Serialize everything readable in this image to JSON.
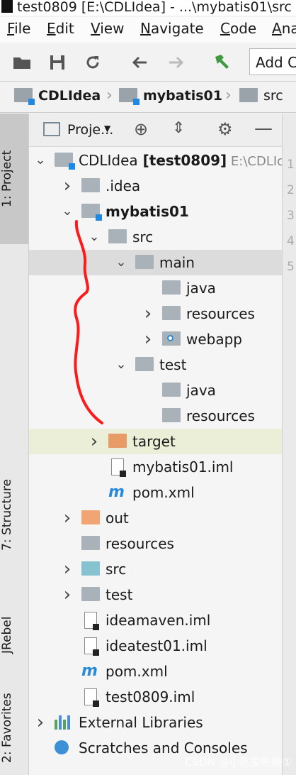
{
  "title": "test0809 [E:\\CDLIdea] - ...\\mybatis01\\src",
  "menu": [
    "File",
    "Edit",
    "View",
    "Navigate",
    "Code",
    "Analyze"
  ],
  "toolbar": {
    "icons": [
      "open-folder-icon",
      "save-icon",
      "refresh-icon",
      "back-arrow-icon",
      "forward-arrow-icon",
      "hammer-icon"
    ],
    "add_config": "Add C"
  },
  "breadcrumb": [
    "CDLIdea",
    "mybatis01",
    "src"
  ],
  "side_tabs": {
    "project": "1: Project",
    "structure": "7: Structure",
    "jrebel": "JRebel",
    "favorites": "2: Favorites"
  },
  "panel": {
    "title": "Proje..."
  },
  "tree": [
    {
      "indent": 0,
      "arrow": "down",
      "icon": "module",
      "label": "CDLIdea",
      "bold_suffix": "[test0809]",
      "path": "E:\\CDLIdea"
    },
    {
      "indent": 1,
      "arrow": "right",
      "icon": "folder",
      "label": ".idea"
    },
    {
      "indent": 1,
      "arrow": "down",
      "icon": "module",
      "label": "mybatis01",
      "bold": true
    },
    {
      "indent": 2,
      "arrow": "down",
      "icon": "folder",
      "label": "src"
    },
    {
      "indent": 3,
      "arrow": "down",
      "icon": "folder",
      "label": "main",
      "sel": true
    },
    {
      "indent": 4,
      "arrow": "",
      "icon": "folder",
      "label": "java"
    },
    {
      "indent": 4,
      "arrow": "right",
      "icon": "folder",
      "label": "resources"
    },
    {
      "indent": 4,
      "arrow": "right",
      "icon": "web",
      "label": "webapp"
    },
    {
      "indent": 3,
      "arrow": "down",
      "icon": "folder",
      "label": "test"
    },
    {
      "indent": 4,
      "arrow": "",
      "icon": "folder",
      "label": "java"
    },
    {
      "indent": 4,
      "arrow": "",
      "icon": "folder",
      "label": "resources"
    },
    {
      "indent": 2,
      "arrow": "right",
      "icon": "orange",
      "label": "target",
      "hl": true
    },
    {
      "indent": 2,
      "arrow": "",
      "icon": "iml",
      "label": "mybatis01.iml"
    },
    {
      "indent": 2,
      "arrow": "",
      "icon": "maven",
      "label": "pom.xml"
    },
    {
      "indent": 1,
      "arrow": "right",
      "icon": "orange2",
      "label": "out"
    },
    {
      "indent": 1,
      "arrow": "",
      "icon": "folder",
      "label": "resources"
    },
    {
      "indent": 1,
      "arrow": "right",
      "icon": "teal",
      "label": "src"
    },
    {
      "indent": 1,
      "arrow": "right",
      "icon": "folder",
      "label": "test"
    },
    {
      "indent": 1,
      "arrow": "",
      "icon": "iml",
      "label": "ideamaven.iml"
    },
    {
      "indent": 1,
      "arrow": "",
      "icon": "iml",
      "label": "ideatest01.iml"
    },
    {
      "indent": 1,
      "arrow": "",
      "icon": "maven",
      "label": "pom.xml"
    },
    {
      "indent": 1,
      "arrow": "",
      "icon": "iml",
      "label": "test0809.iml"
    },
    {
      "indent": 0,
      "arrow": "right",
      "icon": "libs",
      "label": "External Libraries"
    },
    {
      "indent": 0,
      "arrow": "",
      "icon": "scratch",
      "label": "Scratches and Consoles"
    }
  ],
  "gutter_lines": [
    "1",
    "2",
    "3",
    "4",
    "5"
  ],
  "watermark": "CSDN @小陈爱吃糖①"
}
